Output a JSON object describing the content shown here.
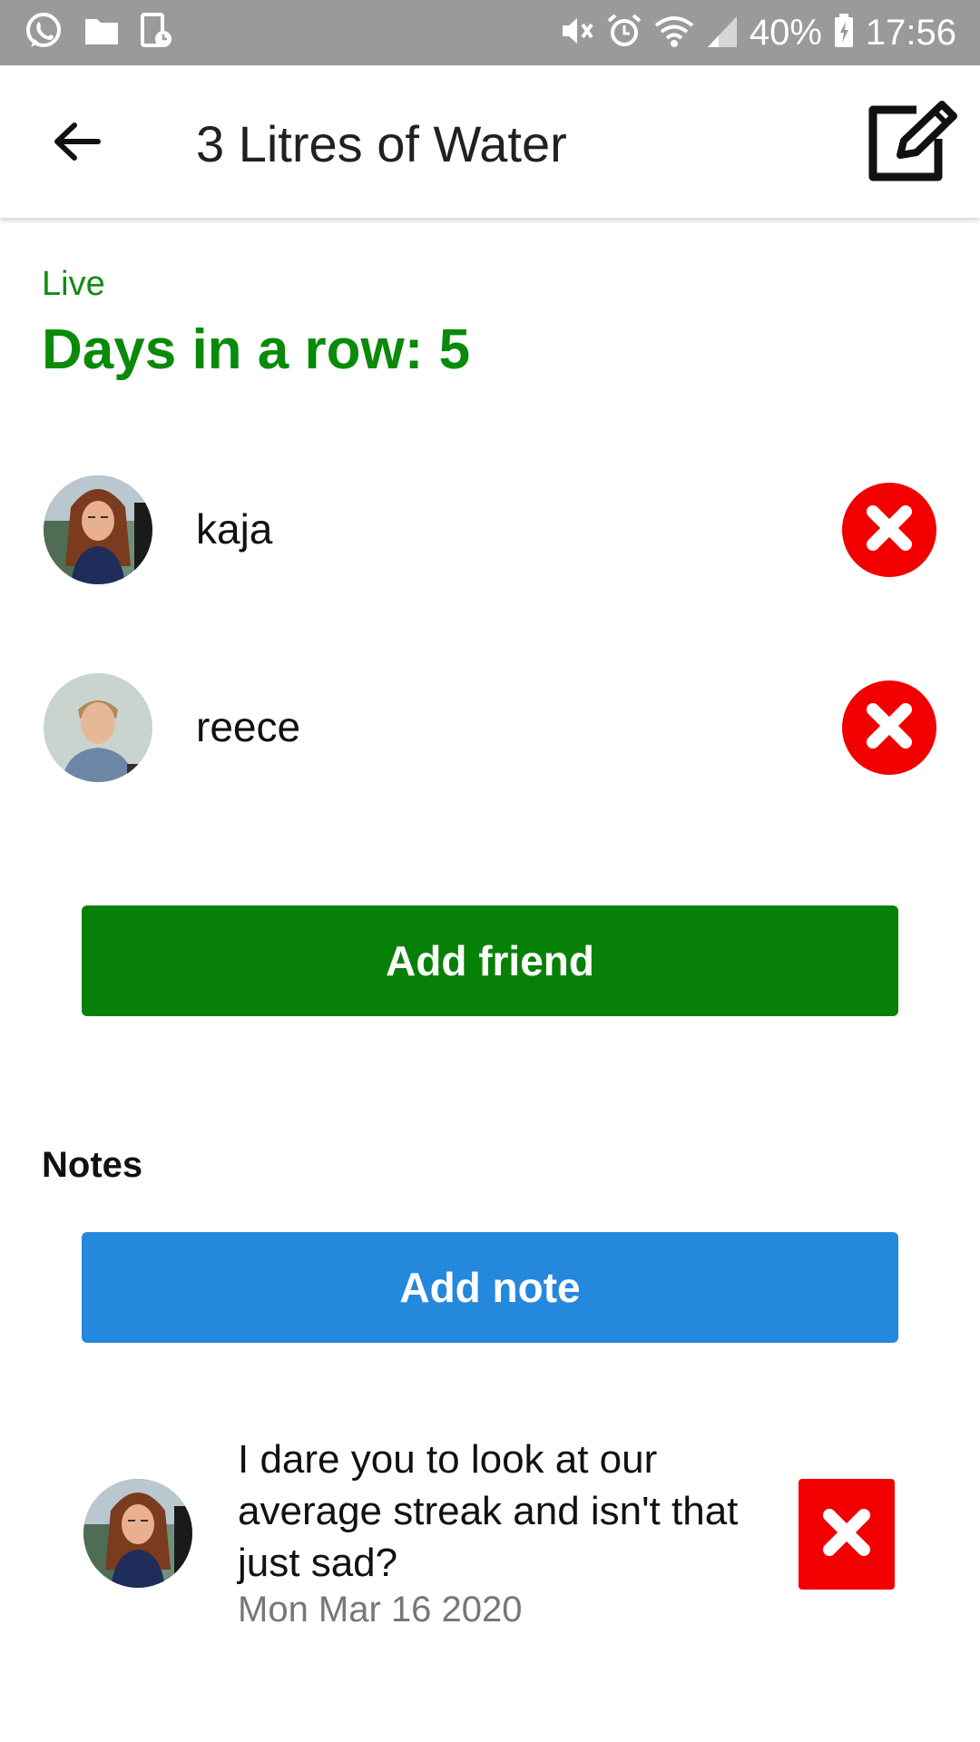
{
  "status_bar": {
    "battery_percent": "40%",
    "time": "17:56",
    "left_icons": [
      "whatsapp-icon",
      "folder-icon",
      "device-timer-icon"
    ],
    "right_icons": [
      "vibrate-mute-icon",
      "alarm-icon",
      "wifi-icon",
      "signal-icon",
      "battery-icon"
    ]
  },
  "app_bar": {
    "title": "3 Litres of Water",
    "back_icon": "arrow-left-icon",
    "edit_icon": "edit-icon"
  },
  "challenge": {
    "status": "Live",
    "streak_text": "Days in a row: 5"
  },
  "friends": [
    {
      "name": "kaja",
      "remove_icon": "remove-circle-icon"
    },
    {
      "name": "reece",
      "remove_icon": "remove-circle-icon"
    }
  ],
  "buttons": {
    "add_friend": "Add friend",
    "add_note": "Add note"
  },
  "notes": {
    "heading": "Notes",
    "items": [
      {
        "text": "I dare you to look at our average streak and isn't that just sad?",
        "date": "Mon Mar 16 2020",
        "remove_icon": "remove-square-icon"
      }
    ]
  },
  "colors": {
    "status_bar": "#9a9a9a",
    "accent_green": "#078007",
    "accent_blue": "#2488dd",
    "danger_red": "#f20000"
  }
}
